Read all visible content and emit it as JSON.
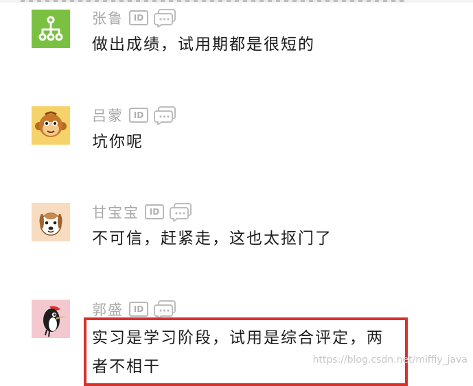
{
  "comments": [
    {
      "author": "张鲁",
      "avatar_icon": "network-tree-icon",
      "avatar_color": "#7ac142",
      "id_badge": "ID",
      "text_lines": [
        "做出成绩，试用期都是很短的"
      ]
    },
    {
      "author": "吕蒙",
      "avatar_icon": "monkey-icon",
      "avatar_color": "#f6d36a",
      "id_badge": "ID",
      "text_lines": [
        "坑你呢"
      ]
    },
    {
      "author": "甘宝宝",
      "avatar_icon": "dog-icon",
      "avatar_color": "#f7dcc0",
      "id_badge": "ID",
      "text_lines": [
        "不可信，赶紧走，这也太抠门了"
      ]
    },
    {
      "author": "郭盛",
      "avatar_icon": "woodpecker-icon",
      "avatar_color": "#f3c9cf",
      "id_badge": "ID",
      "text_lines": [
        "实习是学习阶段，试用是综合评定，两",
        "者不相干"
      ],
      "highlighted": true,
      "highlight_color": "#d9302c"
    }
  ],
  "watermark": "https://blog.csdn.net/miffiy_java"
}
